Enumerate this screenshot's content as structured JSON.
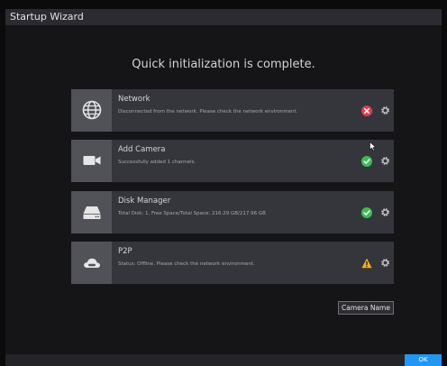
{
  "window": {
    "title": "Startup Wizard"
  },
  "heading": "Quick initialization is complete.",
  "cards": [
    {
      "title": "Network",
      "description": "Disconnected from the network. Please check the network environment.",
      "status": "error",
      "icon": "globe-icon"
    },
    {
      "title": "Add Camera",
      "description": "Successfully added 1 channels.",
      "status": "success",
      "icon": "camera-icon"
    },
    {
      "title": "Disk Manager",
      "description": "Total Disk: 1, Free Space/Total Space: 216.29 GB/217.96 GB",
      "status": "success",
      "icon": "hard-disk-icon"
    },
    {
      "title": "P2P",
      "description": "Status: Offline. Please check the network environment.",
      "status": "warning",
      "icon": "cloud-icon"
    }
  ],
  "buttons": {
    "camera_name": "Camera Name",
    "ok": "OK"
  },
  "colors": {
    "accent": "#2196f3",
    "success": "#3cbd53",
    "error": "#e8374e",
    "warning": "#f2b01e"
  }
}
